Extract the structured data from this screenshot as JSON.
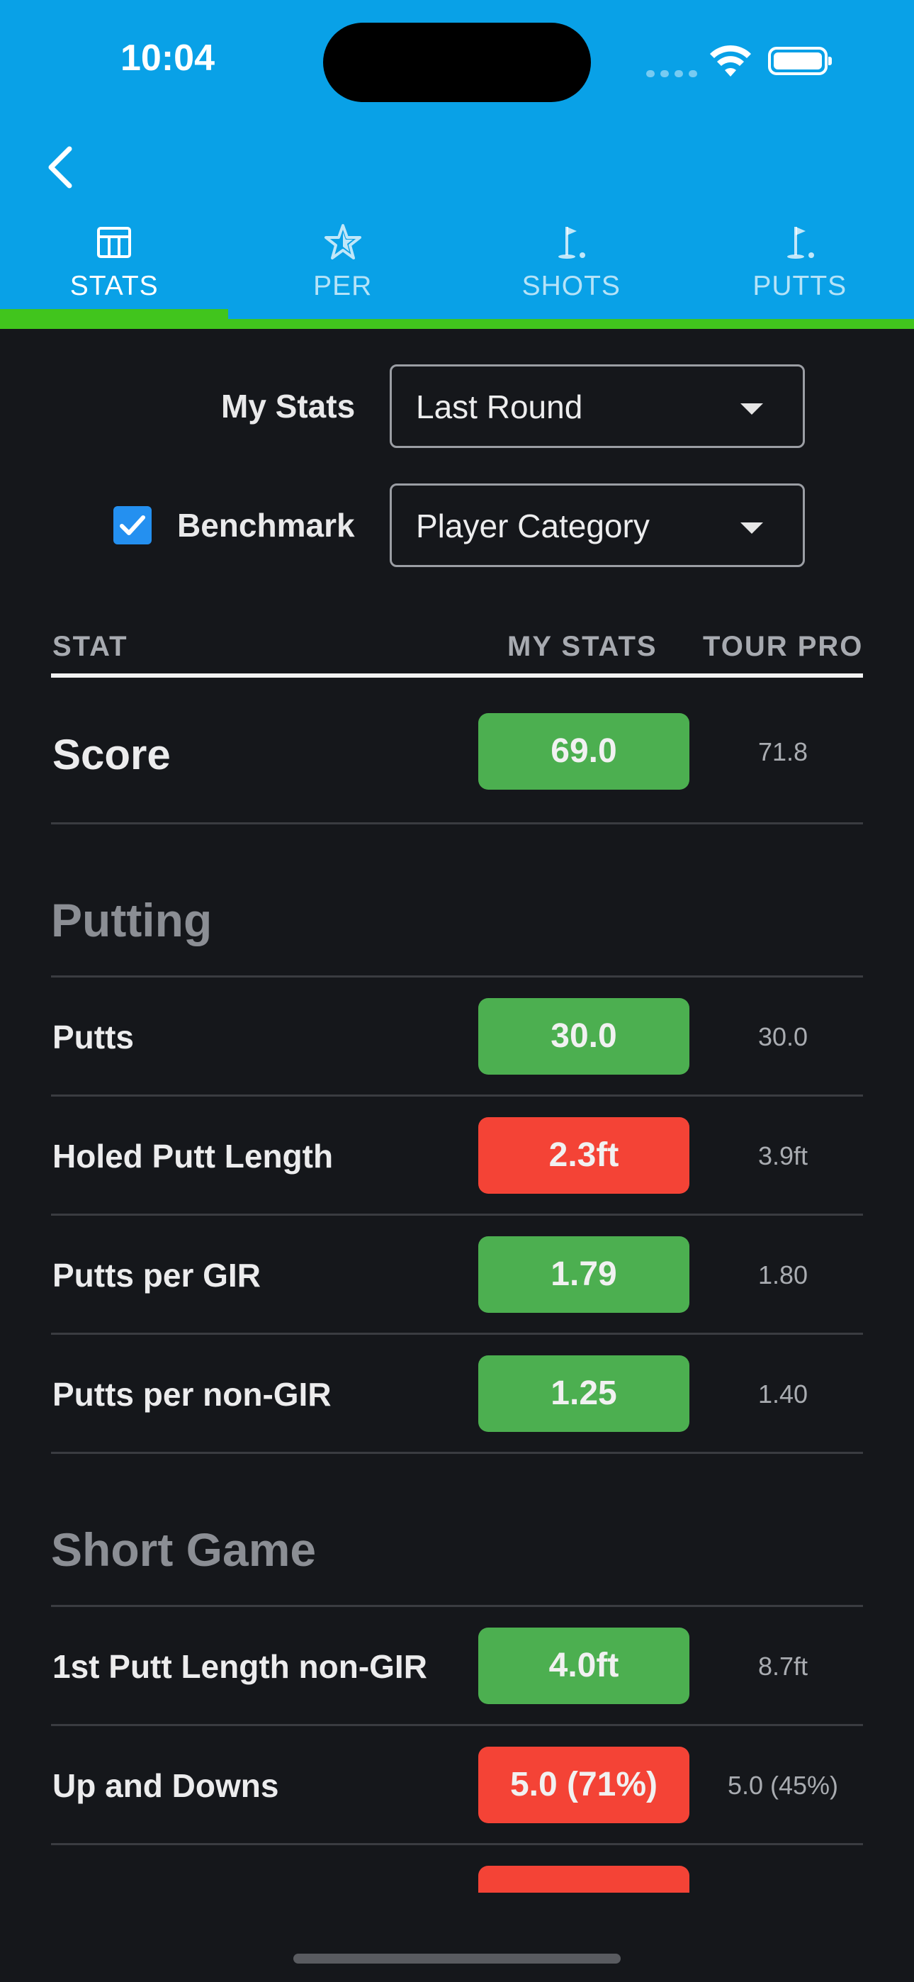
{
  "status": {
    "time": "10:04"
  },
  "tabs": [
    {
      "label": "STATS",
      "icon": "table-icon",
      "active": true
    },
    {
      "label": "PER",
      "icon": "star-icon",
      "active": false
    },
    {
      "label": "SHOTS",
      "icon": "flag-icon",
      "active": false
    },
    {
      "label": "PUTTS",
      "icon": "flag-icon",
      "active": false
    }
  ],
  "filters": {
    "my_stats_label": "My Stats",
    "my_stats_value": "Last Round",
    "benchmark_label": "Benchmark",
    "benchmark_checked": true,
    "benchmark_value": "Player Category"
  },
  "table": {
    "headers": {
      "stat": "STAT",
      "mine": "MY STATS",
      "tour": "TOUR PRO"
    },
    "score": {
      "label": "Score",
      "mine": "69.0",
      "tour": "71.8",
      "status": "good"
    },
    "sections": [
      {
        "title": "Putting",
        "rows": [
          {
            "label": "Putts",
            "mine": "30.0",
            "tour": "30.0",
            "status": "good"
          },
          {
            "label": "Holed Putt Length",
            "mine": "2.3ft",
            "tour": "3.9ft",
            "status": "bad"
          },
          {
            "label": "Putts per GIR",
            "mine": "1.79",
            "tour": "1.80",
            "status": "good"
          },
          {
            "label": "Putts per non-GIR",
            "mine": "1.25",
            "tour": "1.40",
            "status": "good"
          }
        ]
      },
      {
        "title": "Short Game",
        "rows": [
          {
            "label": "1st Putt Length non-GIR",
            "mine": "4.0ft",
            "tour": "8.7ft",
            "status": "good"
          },
          {
            "label": "Up and Downs",
            "mine": "5.0 (71%)",
            "tour": "5.0 (45%)",
            "status": "bad"
          }
        ]
      }
    ]
  },
  "colors": {
    "good": "#4caf50",
    "bad": "#f44336",
    "header": "#09a1e7",
    "accent": "#41c51d"
  }
}
